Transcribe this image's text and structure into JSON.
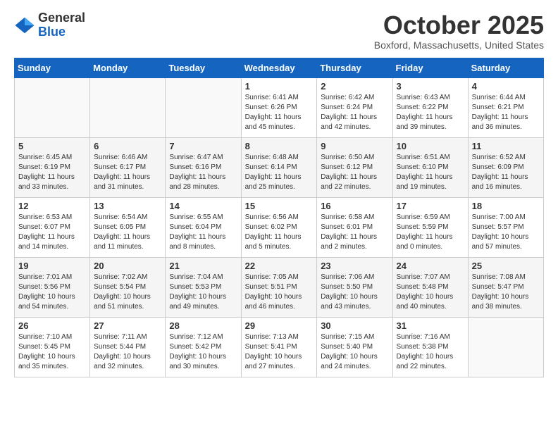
{
  "header": {
    "logo": {
      "general": "General",
      "blue": "Blue"
    },
    "title": "October 2025",
    "location": "Boxford, Massachusetts, United States"
  },
  "weekdays": [
    "Sunday",
    "Monday",
    "Tuesday",
    "Wednesday",
    "Thursday",
    "Friday",
    "Saturday"
  ],
  "weeks": [
    [
      {
        "day": "",
        "text": ""
      },
      {
        "day": "",
        "text": ""
      },
      {
        "day": "",
        "text": ""
      },
      {
        "day": "1",
        "text": "Sunrise: 6:41 AM\nSunset: 6:26 PM\nDaylight: 11 hours\nand 45 minutes."
      },
      {
        "day": "2",
        "text": "Sunrise: 6:42 AM\nSunset: 6:24 PM\nDaylight: 11 hours\nand 42 minutes."
      },
      {
        "day": "3",
        "text": "Sunrise: 6:43 AM\nSunset: 6:22 PM\nDaylight: 11 hours\nand 39 minutes."
      },
      {
        "day": "4",
        "text": "Sunrise: 6:44 AM\nSunset: 6:21 PM\nDaylight: 11 hours\nand 36 minutes."
      }
    ],
    [
      {
        "day": "5",
        "text": "Sunrise: 6:45 AM\nSunset: 6:19 PM\nDaylight: 11 hours\nand 33 minutes."
      },
      {
        "day": "6",
        "text": "Sunrise: 6:46 AM\nSunset: 6:17 PM\nDaylight: 11 hours\nand 31 minutes."
      },
      {
        "day": "7",
        "text": "Sunrise: 6:47 AM\nSunset: 6:16 PM\nDaylight: 11 hours\nand 28 minutes."
      },
      {
        "day": "8",
        "text": "Sunrise: 6:48 AM\nSunset: 6:14 PM\nDaylight: 11 hours\nand 25 minutes."
      },
      {
        "day": "9",
        "text": "Sunrise: 6:50 AM\nSunset: 6:12 PM\nDaylight: 11 hours\nand 22 minutes."
      },
      {
        "day": "10",
        "text": "Sunrise: 6:51 AM\nSunset: 6:10 PM\nDaylight: 11 hours\nand 19 minutes."
      },
      {
        "day": "11",
        "text": "Sunrise: 6:52 AM\nSunset: 6:09 PM\nDaylight: 11 hours\nand 16 minutes."
      }
    ],
    [
      {
        "day": "12",
        "text": "Sunrise: 6:53 AM\nSunset: 6:07 PM\nDaylight: 11 hours\nand 14 minutes."
      },
      {
        "day": "13",
        "text": "Sunrise: 6:54 AM\nSunset: 6:05 PM\nDaylight: 11 hours\nand 11 minutes."
      },
      {
        "day": "14",
        "text": "Sunrise: 6:55 AM\nSunset: 6:04 PM\nDaylight: 11 hours\nand 8 minutes."
      },
      {
        "day": "15",
        "text": "Sunrise: 6:56 AM\nSunset: 6:02 PM\nDaylight: 11 hours\nand 5 minutes."
      },
      {
        "day": "16",
        "text": "Sunrise: 6:58 AM\nSunset: 6:01 PM\nDaylight: 11 hours\nand 2 minutes."
      },
      {
        "day": "17",
        "text": "Sunrise: 6:59 AM\nSunset: 5:59 PM\nDaylight: 11 hours\nand 0 minutes."
      },
      {
        "day": "18",
        "text": "Sunrise: 7:00 AM\nSunset: 5:57 PM\nDaylight: 10 hours\nand 57 minutes."
      }
    ],
    [
      {
        "day": "19",
        "text": "Sunrise: 7:01 AM\nSunset: 5:56 PM\nDaylight: 10 hours\nand 54 minutes."
      },
      {
        "day": "20",
        "text": "Sunrise: 7:02 AM\nSunset: 5:54 PM\nDaylight: 10 hours\nand 51 minutes."
      },
      {
        "day": "21",
        "text": "Sunrise: 7:04 AM\nSunset: 5:53 PM\nDaylight: 10 hours\nand 49 minutes."
      },
      {
        "day": "22",
        "text": "Sunrise: 7:05 AM\nSunset: 5:51 PM\nDaylight: 10 hours\nand 46 minutes."
      },
      {
        "day": "23",
        "text": "Sunrise: 7:06 AM\nSunset: 5:50 PM\nDaylight: 10 hours\nand 43 minutes."
      },
      {
        "day": "24",
        "text": "Sunrise: 7:07 AM\nSunset: 5:48 PM\nDaylight: 10 hours\nand 40 minutes."
      },
      {
        "day": "25",
        "text": "Sunrise: 7:08 AM\nSunset: 5:47 PM\nDaylight: 10 hours\nand 38 minutes."
      }
    ],
    [
      {
        "day": "26",
        "text": "Sunrise: 7:10 AM\nSunset: 5:45 PM\nDaylight: 10 hours\nand 35 minutes."
      },
      {
        "day": "27",
        "text": "Sunrise: 7:11 AM\nSunset: 5:44 PM\nDaylight: 10 hours\nand 32 minutes."
      },
      {
        "day": "28",
        "text": "Sunrise: 7:12 AM\nSunset: 5:42 PM\nDaylight: 10 hours\nand 30 minutes."
      },
      {
        "day": "29",
        "text": "Sunrise: 7:13 AM\nSunset: 5:41 PM\nDaylight: 10 hours\nand 27 minutes."
      },
      {
        "day": "30",
        "text": "Sunrise: 7:15 AM\nSunset: 5:40 PM\nDaylight: 10 hours\nand 24 minutes."
      },
      {
        "day": "31",
        "text": "Sunrise: 7:16 AM\nSunset: 5:38 PM\nDaylight: 10 hours\nand 22 minutes."
      },
      {
        "day": "",
        "text": ""
      }
    ]
  ]
}
